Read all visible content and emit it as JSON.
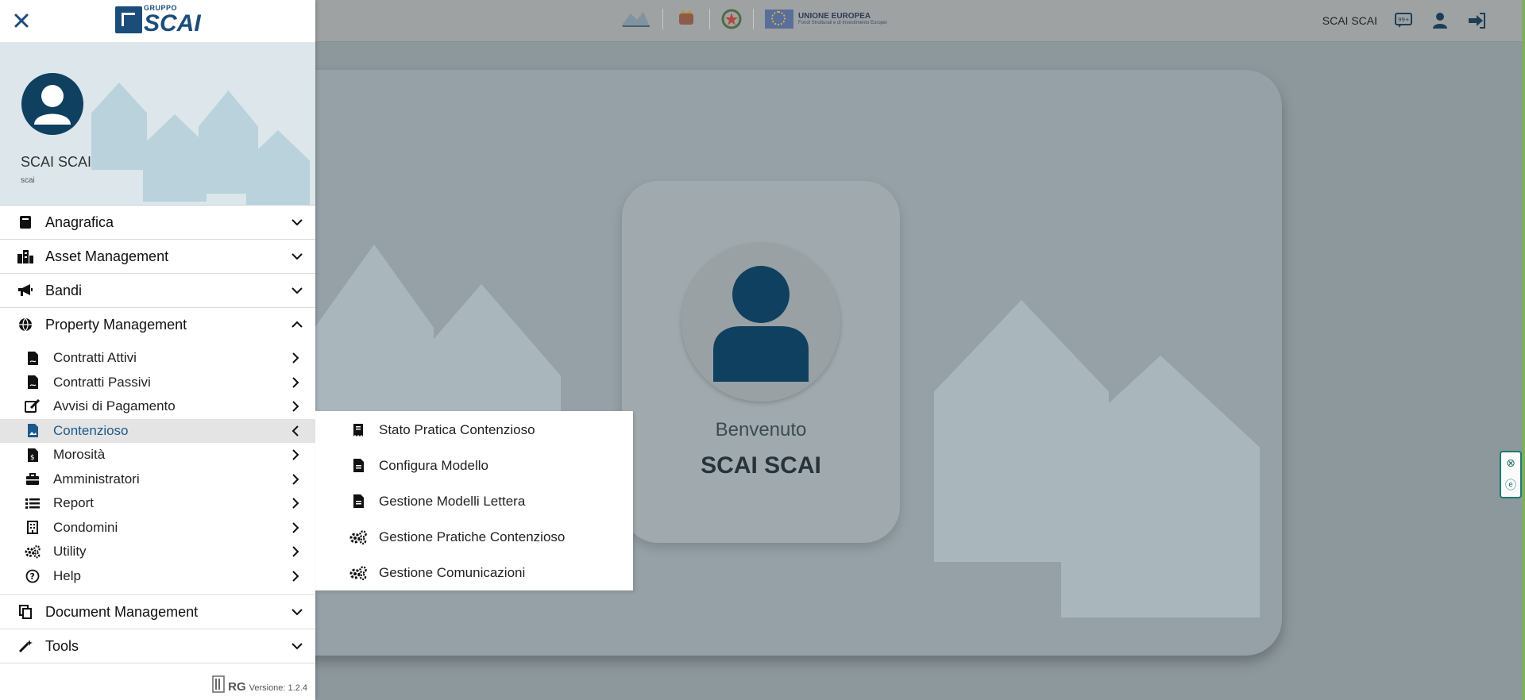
{
  "topbar": {
    "user_name": "SCAI SCAI",
    "eu_title": "UNIONE EUROPEA",
    "eu_subtitle": "Fondi Strutturali e di Investimento Europei",
    "icons": [
      "chat-icon",
      "user-icon",
      "logout-icon"
    ]
  },
  "welcome": {
    "title": "Benvenuto",
    "name": "SCAI SCAI"
  },
  "sidebar": {
    "brand_small": "GRUPPO",
    "brand_big": "SCAI",
    "profile": {
      "name": "SCAI SCAI",
      "username": "scai"
    },
    "menu": [
      {
        "label": "Anagrafica",
        "icon": "address-book-icon",
        "expanded": false
      },
      {
        "label": "Asset Management",
        "icon": "city-icon",
        "expanded": false
      },
      {
        "label": "Bandi",
        "icon": "bullhorn-icon",
        "expanded": false
      },
      {
        "label": "Property Management",
        "icon": "globe-icon",
        "expanded": true
      },
      {
        "label": "Document Management",
        "icon": "copy-icon",
        "expanded": false
      },
      {
        "label": "Tools",
        "icon": "magic-icon",
        "expanded": false
      }
    ],
    "submenu": [
      {
        "label": "Contratti Attivi",
        "icon": "file-contract-icon"
      },
      {
        "label": "Contratti Passivi",
        "icon": "file-contract-icon"
      },
      {
        "label": "Avvisi di Pagamento",
        "icon": "edit-icon"
      },
      {
        "label": "Contenzioso",
        "icon": "file-image-icon",
        "active": true
      },
      {
        "label": "Morosità",
        "icon": "file-invoice-icon"
      },
      {
        "label": "Amministratori",
        "icon": "briefcase-icon"
      },
      {
        "label": "Report",
        "icon": "list-icon"
      },
      {
        "label": "Condomini",
        "icon": "building-icon"
      },
      {
        "label": "Utility",
        "icon": "cogs-icon"
      },
      {
        "label": "Help",
        "icon": "question-circle-icon"
      }
    ],
    "version_logo": "RG",
    "version": "Versione: 1.2.4"
  },
  "flyout": [
    {
      "label": "Stato Pratica Contenzioso",
      "icon": "receipt-icon"
    },
    {
      "label": "Configura Modello",
      "icon": "file-icon"
    },
    {
      "label": "Gestione Modelli Lettera",
      "icon": "file-icon"
    },
    {
      "label": "Gestione Pratiche Contenzioso",
      "icon": "cogs-icon"
    },
    {
      "label": "Gestione Comunicazioni",
      "icon": "cogs-icon"
    }
  ],
  "colors": {
    "brand": "#1c4d7a",
    "avatar": "#0f405f",
    "active_text": "#1c5a8c",
    "overlay_bg": "#8d989d"
  }
}
